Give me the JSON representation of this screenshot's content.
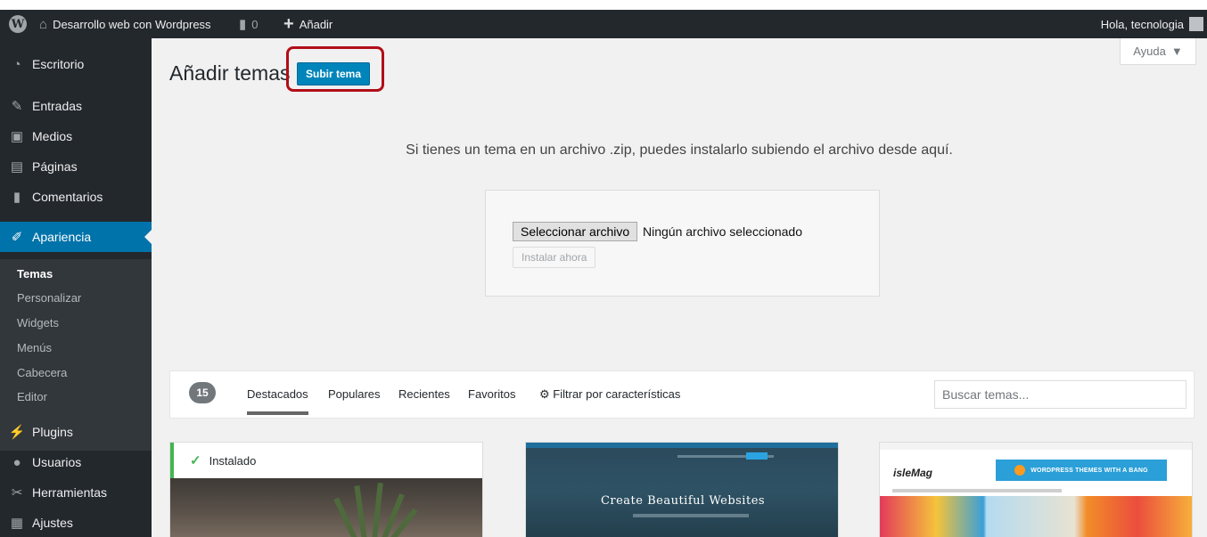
{
  "admin_bar": {
    "site_name": "Desarrollo web con Wordpress",
    "comment_count": "0",
    "new_label": "Añadir",
    "greeting": "Hola, tecnologia"
  },
  "sidebar": {
    "items": [
      {
        "label": "Escritorio",
        "icon": "dashboard-icon"
      },
      {
        "label": "Entradas",
        "icon": "pin-icon"
      },
      {
        "label": "Medios",
        "icon": "media-icon"
      },
      {
        "label": "Páginas",
        "icon": "pages-icon"
      },
      {
        "label": "Comentarios",
        "icon": "comment-icon"
      },
      {
        "label": "Apariencia",
        "icon": "paintbrush-icon"
      },
      {
        "label": "Plugins",
        "icon": "plug-icon"
      },
      {
        "label": "Usuarios",
        "icon": "users-icon"
      },
      {
        "label": "Herramientas",
        "icon": "wrench-icon"
      },
      {
        "label": "Ajustes",
        "icon": "settings-icon"
      }
    ],
    "submenu": [
      "Temas",
      "Personalizar",
      "Widgets",
      "Menús",
      "Cabecera",
      "Editor"
    ]
  },
  "page": {
    "title": "Añadir temas",
    "upload_button": "Subir tema",
    "help_tab": "Ayuda",
    "upload_intro": "Si tienes un tema en un archivo .zip, puedes instalarlo subiendo el archivo desde aquí.",
    "file_button": "Seleccionar archivo",
    "file_status": "Ningún archivo seleccionado",
    "install_button": "Instalar ahora"
  },
  "filter_bar": {
    "count": "15",
    "tabs": [
      "Destacados",
      "Populares",
      "Recientes",
      "Favoritos"
    ],
    "feature_filter": "Filtrar por características",
    "search_placeholder": "Buscar temas..."
  },
  "themes": {
    "installed_label": "Instalado",
    "theme2_headline": "Create Beautiful Websites",
    "theme3_logo": "isleMag",
    "theme3_banner": "WORDPRESS THEMES WITH A BANG"
  },
  "colors": {
    "admin_bar": "#23282d",
    "accent": "#0073aa",
    "primary_button": "#0085ba",
    "highlight_box": "#b10e17",
    "installed_green": "#46b450"
  }
}
